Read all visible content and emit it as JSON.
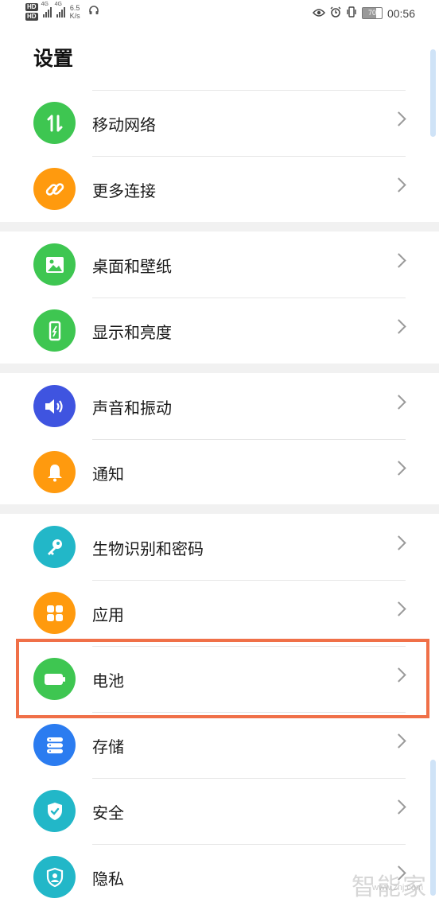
{
  "status_bar": {
    "hd_labels": [
      "HD",
      "HD"
    ],
    "network_labels": [
      "4G",
      "4G"
    ],
    "speed_value": "6.5",
    "speed_unit": "K/s",
    "battery_level": "70",
    "time": "00:56"
  },
  "page_title": "设置",
  "sections": [
    {
      "items": [
        {
          "label": "移动网络",
          "icon": "arrows-updown-icon",
          "color": "#3ec651"
        },
        {
          "label": "更多连接",
          "icon": "link-icon",
          "color": "#ff9a0e"
        }
      ]
    },
    {
      "items": [
        {
          "label": "桌面和壁纸",
          "icon": "image-icon",
          "color": "#3ec651"
        },
        {
          "label": "显示和亮度",
          "icon": "phone-brightness-icon",
          "color": "#3ec651"
        }
      ]
    },
    {
      "items": [
        {
          "label": "声音和振动",
          "icon": "speaker-icon",
          "color": "#3f54e0"
        },
        {
          "label": "通知",
          "icon": "bell-icon",
          "color": "#ff9a0e"
        }
      ]
    },
    {
      "items": [
        {
          "label": "生物识别和密码",
          "icon": "key-icon",
          "color": "#22b7c8"
        },
        {
          "label": "应用",
          "icon": "apps-grid-icon",
          "color": "#ff9a0e"
        },
        {
          "label": "电池",
          "icon": "battery-icon",
          "color": "#3ec651"
        },
        {
          "label": "存储",
          "icon": "storage-icon",
          "color": "#2b7cf0"
        },
        {
          "label": "安全",
          "icon": "shield-check-icon",
          "color": "#22b7c8"
        },
        {
          "label": "隐私",
          "icon": "privacy-icon",
          "color": "#22b7c8"
        }
      ]
    }
  ],
  "watermark": {
    "text": "智能家",
    "sub": "www.znj.com"
  }
}
